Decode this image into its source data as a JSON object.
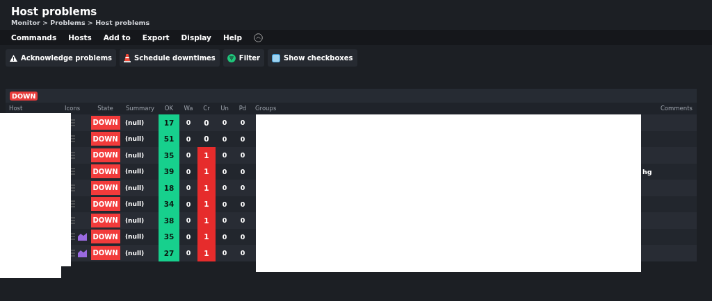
{
  "title": "Host problems",
  "breadcrumb": "Monitor > Problems > Host problems",
  "menu": [
    "Commands",
    "Hosts",
    "Add to",
    "Export",
    "Display",
    "Help"
  ],
  "actions": [
    {
      "kind": "warning",
      "label": "Acknowledge problems"
    },
    {
      "kind": "cone",
      "label": "Schedule downtimes"
    },
    {
      "kind": "filter",
      "label": "Filter"
    },
    {
      "kind": "checkbox",
      "label": "Show checkboxes"
    }
  ],
  "group_badge": "DOWN",
  "columns": [
    "Host",
    "Icons",
    "State",
    "Summary",
    "OK",
    "Wa",
    "Cr",
    "Un",
    "Pd",
    "Groups",
    "Comments"
  ],
  "rows": [
    {
      "graph": false,
      "state": "DOWN",
      "summary": "(null)",
      "ok": "17",
      "wa": "0",
      "cr": "0",
      "un": "0",
      "pd": "0",
      "comment": ""
    },
    {
      "graph": false,
      "state": "DOWN",
      "summary": "(null)",
      "ok": "51",
      "wa": "0",
      "cr": "0",
      "un": "0",
      "pd": "0",
      "comment": ""
    },
    {
      "graph": false,
      "state": "DOWN",
      "summary": "(null)",
      "ok": "35",
      "wa": "0",
      "cr": "1",
      "un": "0",
      "pd": "0",
      "comment": ""
    },
    {
      "graph": false,
      "state": "DOWN",
      "summary": "(null)",
      "ok": "39",
      "wa": "0",
      "cr": "1",
      "un": "0",
      "pd": "0",
      "comment": "hg"
    },
    {
      "graph": false,
      "state": "DOWN",
      "summary": "(null)",
      "ok": "18",
      "wa": "0",
      "cr": "1",
      "un": "0",
      "pd": "0",
      "comment": ""
    },
    {
      "graph": false,
      "state": "DOWN",
      "summary": "(null)",
      "ok": "34",
      "wa": "0",
      "cr": "1",
      "un": "0",
      "pd": "0",
      "comment": ""
    },
    {
      "graph": false,
      "state": "DOWN",
      "summary": "(null)",
      "ok": "38",
      "wa": "0",
      "cr": "1",
      "un": "0",
      "pd": "0",
      "comment": ""
    },
    {
      "graph": true,
      "state": "DOWN",
      "summary": "(null)",
      "ok": "35",
      "wa": "0",
      "cr": "1",
      "un": "0",
      "pd": "0",
      "comment": ""
    },
    {
      "graph": true,
      "state": "DOWN",
      "summary": "(null)",
      "ok": "27",
      "wa": "0",
      "cr": "1",
      "un": "0",
      "pd": "0",
      "comment": ""
    }
  ]
}
